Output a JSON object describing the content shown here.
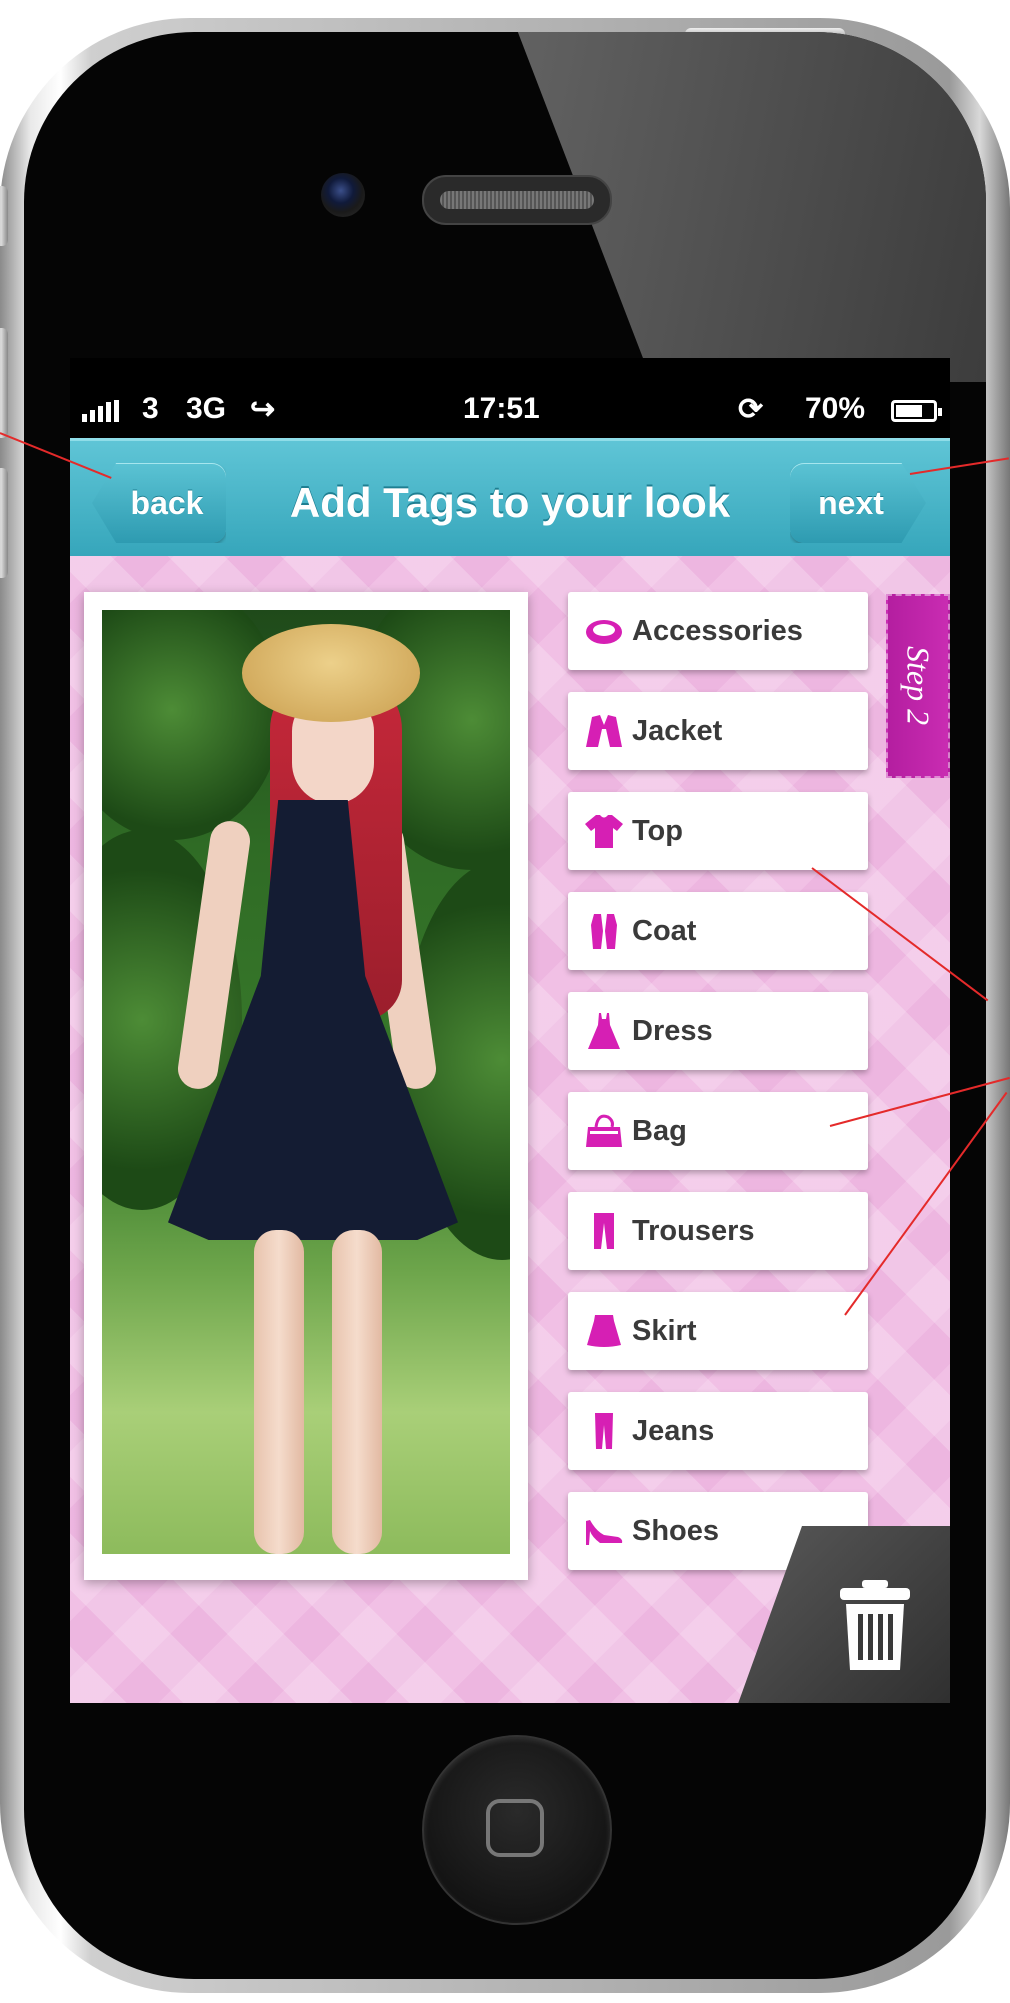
{
  "status_bar": {
    "carrier": "3",
    "network": "3G",
    "time": "17:51",
    "battery": "70%"
  },
  "nav": {
    "back_label": "back",
    "title": "Add Tags to your look",
    "next_label": "next"
  },
  "step_label": "Step 2",
  "tags": [
    {
      "label": "Accessories",
      "icon": "bracelet-icon"
    },
    {
      "label": "Jacket",
      "icon": "jacket-icon"
    },
    {
      "label": "Top",
      "icon": "tshirt-icon"
    },
    {
      "label": "Coat",
      "icon": "coat-icon"
    },
    {
      "label": "Dress",
      "icon": "dress-icon"
    },
    {
      "label": "Bag",
      "icon": "handbag-icon"
    },
    {
      "label": "Trousers",
      "icon": "trousers-icon"
    },
    {
      "label": "Skirt",
      "icon": "skirt-icon"
    },
    {
      "label": "Jeans",
      "icon": "jeans-icon"
    },
    {
      "label": "Shoes",
      "icon": "shoe-icon"
    }
  ],
  "colors": {
    "nav_blue": "#3fb0c4",
    "accent_magenta": "#d61fb4",
    "background_pink": "#f1c0e5",
    "ribbon_purple": "#b41ea0",
    "callout_red": "#e42a2a"
  }
}
